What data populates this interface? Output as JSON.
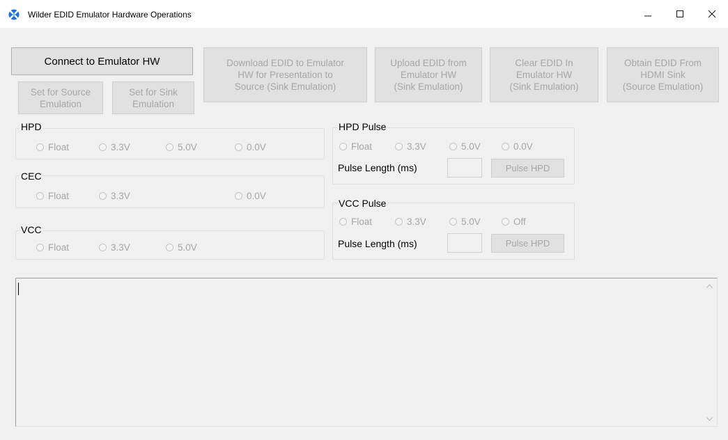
{
  "window": {
    "title": "Wilder EDID Emulator  Hardware Operations"
  },
  "buttons": {
    "connect": "Connect to Emulator HW",
    "download": "Download EDID to Emulator\nHW for Presentation to\nSource (Sink Emulation)",
    "upload": "Upload EDID from\nEmulator HW\n(Sink Emulation)",
    "clear": "Clear EDID In\nEmulator HW\n(Sink Emulation)",
    "obtain": "Obtain EDID From\nHDMI Sink\n(Source Emulation)",
    "set_source": "Set for Source\nEmulation",
    "set_sink": "Set for Sink\nEmulation"
  },
  "hpd": {
    "legend": "HPD",
    "options": [
      "Float",
      "3.3V",
      "5.0V",
      "0.0V"
    ]
  },
  "cec": {
    "legend": "CEC",
    "options": [
      "Float",
      "3.3V",
      "0.0V"
    ]
  },
  "vcc": {
    "legend": "VCC",
    "options": [
      "Float",
      "3.3V",
      "5.0V"
    ]
  },
  "hpd_pulse": {
    "legend": "HPD Pulse",
    "options": [
      "Float",
      "3.3V",
      "5.0V",
      "0.0V"
    ],
    "pulse_label": "Pulse Length (ms)",
    "pulse_value": "",
    "button": "Pulse HPD"
  },
  "vcc_pulse": {
    "legend": "VCC Pulse",
    "options": [
      "Float",
      "3.3V",
      "5.0V",
      "Off"
    ],
    "pulse_label": "Pulse Length (ms)",
    "pulse_value": "",
    "button": "Pulse HPD"
  },
  "log": {
    "text": ""
  },
  "icons": {
    "app": "app-logo-icon",
    "minimize": "minimize-icon",
    "maximize": "maximize-icon",
    "close": "close-icon",
    "scroll_up": "scroll-up-arrow-icon",
    "scroll_down": "scroll-down-arrow-icon"
  },
  "colors": {
    "background": "#f0f0f0",
    "disabled_text": "#a6a6a6",
    "app_icon_blue": "#1e6fd9"
  }
}
